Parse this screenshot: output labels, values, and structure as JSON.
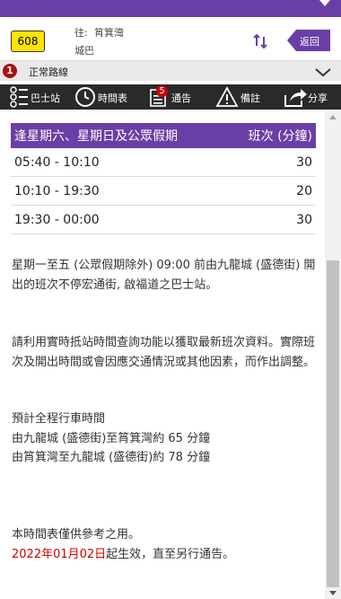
{
  "header": {
    "route_number": "608",
    "destination_prefix": "往:",
    "destination": "筲箕灣",
    "operator": "城巴",
    "back_label": "返回"
  },
  "route_bar": {
    "route_index": "1",
    "route_type": "正常路線"
  },
  "toolbar": {
    "items": [
      {
        "label": "巴士站",
        "icon": "bus-stop-list-icon"
      },
      {
        "label": "時間表",
        "icon": "clock-icon"
      },
      {
        "label": "通告",
        "icon": "notice-icon",
        "badge": "5"
      },
      {
        "label": "備註",
        "icon": "warning-icon"
      },
      {
        "label": "分享",
        "icon": "share-icon"
      }
    ]
  },
  "timetable": {
    "header_period": "逢星期六、星期日及公眾假期",
    "header_freq": "班次 (分鐘)",
    "rows": [
      {
        "time": "05:40 - 10:10",
        "freq": "30"
      },
      {
        "time": "10:10 - 19:30",
        "freq": "20"
      },
      {
        "time": "19:30 - 00:00",
        "freq": "30"
      }
    ]
  },
  "notes": {
    "weekday_note": "星期一至五 (公眾假期除外) 09:00 前由九龍城 (盛德街) 開出的班次不停宏通街, 啟福道之巴士站。",
    "realtime_note": "請利用實時抵站時間查詢功能以獲取最新班次資料。實際班次及開出時間或會因應交通情況或其他因素，而作出調整。",
    "journey_title": "預計全程行車時間",
    "journey_line1": "由九龍城 (盛德街)至筲箕灣約 65 分鐘",
    "journey_line2": "由筲箕灣至九龍城 (盛德街)約 78 分鐘",
    "reference_note": "本時間表僅供參考之用。",
    "effective_date": "2022年01月02日",
    "effective_suffix": "起生效，直至另行通告。"
  },
  "colors": {
    "brand_purple": "#6a3fa5",
    "route_yellow": "#ffe400",
    "toolbar_dark": "#2a2a2a",
    "alert_red": "#c00000"
  }
}
